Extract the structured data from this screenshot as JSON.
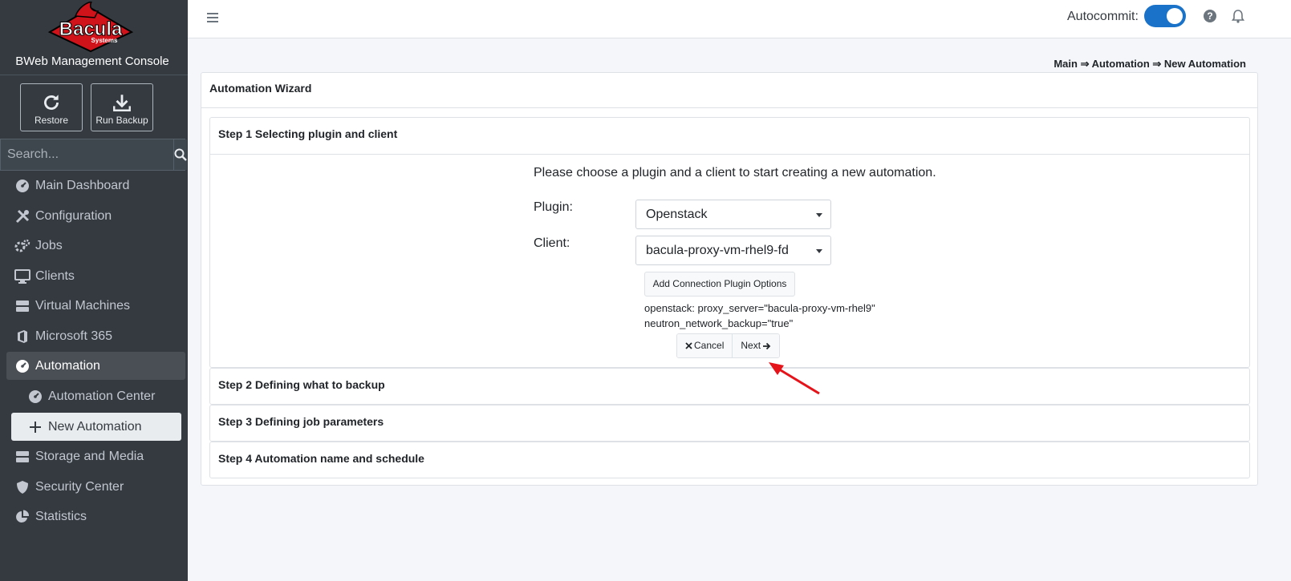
{
  "brand": {
    "logo_text": "Bacula",
    "logo_sub": "Systems",
    "title": "BWeb Management Console"
  },
  "quick_actions": {
    "restore": "Restore",
    "run_backup": "Run Backup"
  },
  "search": {
    "placeholder": "Search..."
  },
  "sidebar": {
    "items": [
      {
        "label": "Main Dashboard",
        "icon": "dashboard-icon"
      },
      {
        "label": "Configuration",
        "icon": "tools-icon"
      },
      {
        "label": "Jobs",
        "icon": "cogs-icon"
      },
      {
        "label": "Clients",
        "icon": "desktop-icon"
      },
      {
        "label": "Virtual Machines",
        "icon": "server-icon"
      },
      {
        "label": "Microsoft 365",
        "icon": "office-icon"
      },
      {
        "label": "Automation",
        "icon": "dashboard-icon"
      },
      {
        "label": "Automation Center",
        "icon": "dashboard-icon"
      },
      {
        "label": "New Automation",
        "icon": "plus-icon"
      },
      {
        "label": "Storage and Media",
        "icon": "storage-icon"
      },
      {
        "label": "Security Center",
        "icon": "shield-icon"
      },
      {
        "label": "Statistics",
        "icon": "pie-chart-icon"
      }
    ]
  },
  "topbar": {
    "autocommit_label": "Autocommit:",
    "autocommit_on": true
  },
  "breadcrumb": {
    "text": "Main ⇒ Automation ⇒ New Automation"
  },
  "wizard": {
    "title": "Automation Wizard",
    "steps": [
      {
        "title": "Step 1 Selecting plugin and client"
      },
      {
        "title": "Step 2 Defining what to backup"
      },
      {
        "title": "Step 3 Defining job parameters"
      },
      {
        "title": "Step 4 Automation name and schedule"
      }
    ],
    "intro": "Please choose a plugin and a client to start creating a new automation.",
    "plugin_label": "Plugin:",
    "plugin_value": "Openstack",
    "client_label": "Client:",
    "client_value": "bacula-proxy-vm-rhel9-fd",
    "add_options_label": "Add Connection Plugin Options",
    "options_line1": "openstack: proxy_server=\"bacula-proxy-vm-rhel9\"",
    "options_line2": "neutron_network_backup=\"true\"",
    "cancel_label": "Cancel",
    "next_label": "Next"
  },
  "colors": {
    "sidebar_bg": "#343a40",
    "accent": "#1a73c8",
    "annotation_arrow": "#e5141b"
  }
}
